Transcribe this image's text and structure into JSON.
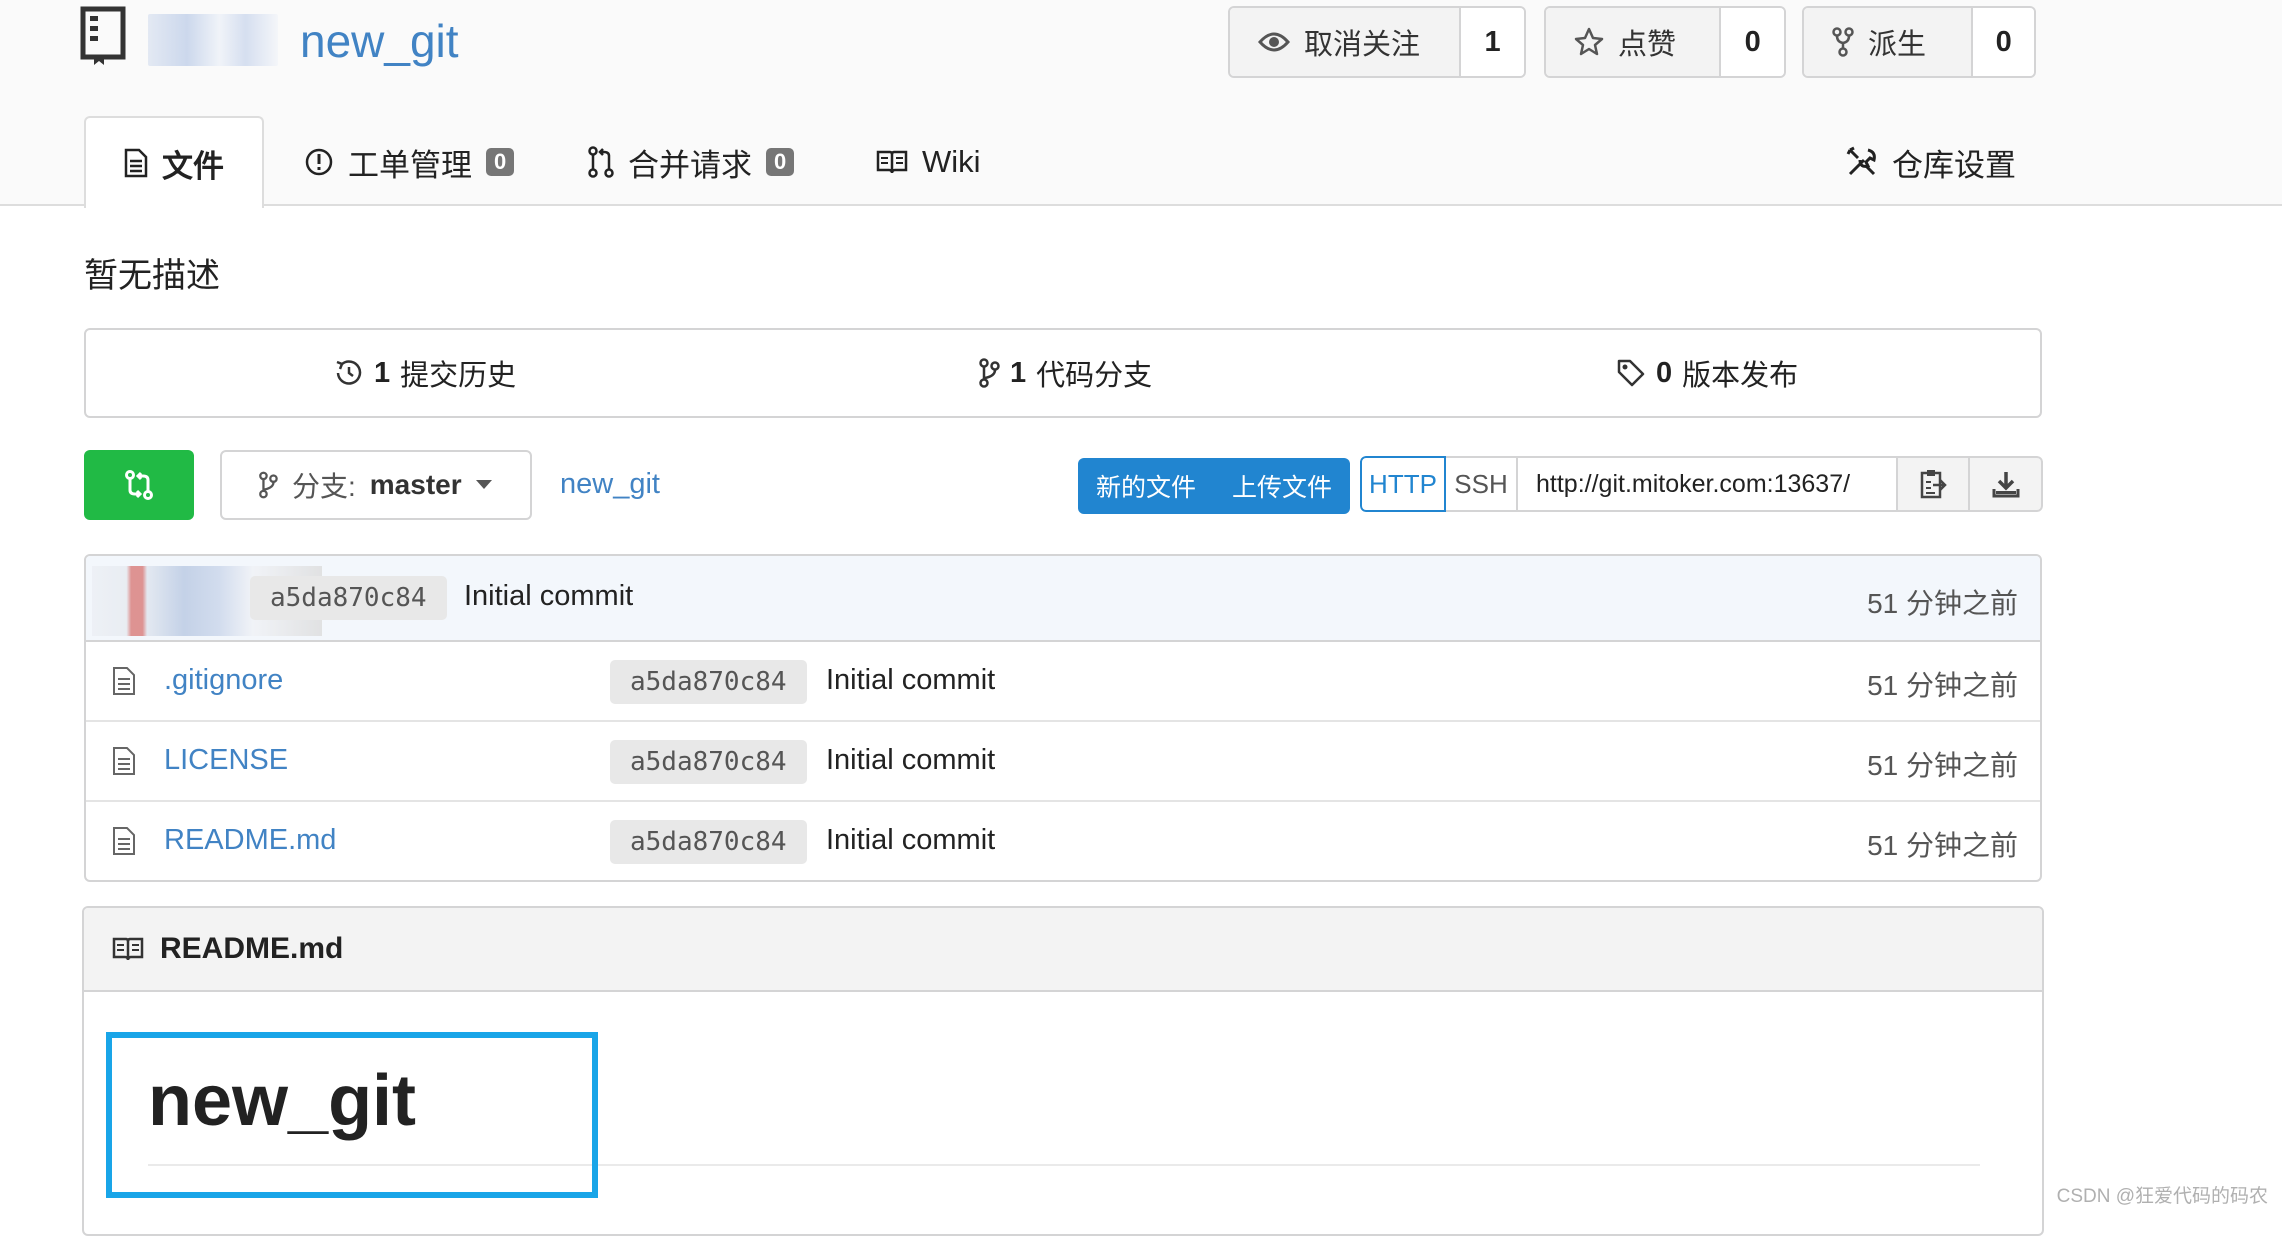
{
  "repo": {
    "name": "new_git"
  },
  "header_actions": {
    "watch": {
      "label": "取消关注",
      "count": "1",
      "icon": "eye-icon"
    },
    "star": {
      "label": "点赞",
      "count": "0",
      "icon": "star-icon"
    },
    "fork": {
      "label": "派生",
      "count": "0",
      "icon": "fork-icon"
    }
  },
  "tabs": [
    {
      "label": "文件",
      "icon": "file-text-icon",
      "active": true
    },
    {
      "label": "工单管理",
      "icon": "issue-icon",
      "count": "0"
    },
    {
      "label": "合并请求",
      "icon": "pull-request-icon",
      "count": "0"
    },
    {
      "label": "Wiki",
      "icon": "book-icon"
    },
    {
      "label": "仓库设置",
      "icon": "tools-icon"
    }
  ],
  "description": "暂无描述",
  "stats": {
    "commits": {
      "count": "1",
      "label": "提交历史",
      "icon": "history-icon"
    },
    "branches": {
      "count": "1",
      "label": "代码分支",
      "icon": "branch-icon"
    },
    "releases": {
      "count": "0",
      "label": "版本发布",
      "icon": "tag-icon"
    }
  },
  "toolbar": {
    "branch_prefix": "分支:",
    "branch_name": "master",
    "breadcrumb": "new_git",
    "new_file": "新的文件",
    "upload_file": "上传文件",
    "protocol_http": "HTTP",
    "protocol_ssh": "SSH",
    "clone_url": "http://git.mitoker.com:13637/"
  },
  "latest_commit": {
    "sha": "a5da870c84",
    "message": "Initial commit",
    "age": "51 分钟之前"
  },
  "files": [
    {
      "name": ".gitignore",
      "sha": "a5da870c84",
      "message": "Initial commit",
      "age": "51 分钟之前"
    },
    {
      "name": "LICENSE",
      "sha": "a5da870c84",
      "message": "Initial commit",
      "age": "51 分钟之前"
    },
    {
      "name": "README.md",
      "sha": "a5da870c84",
      "message": "Initial commit",
      "age": "51 分钟之前"
    }
  ],
  "readme": {
    "filename": "README.md",
    "heading": "new_git"
  },
  "watermark": "CSDN @狂爱代码的码农",
  "colors": {
    "link": "#4183c4",
    "primary": "#2185d0",
    "success": "#21ba45",
    "highlight": "#19a5e8"
  }
}
